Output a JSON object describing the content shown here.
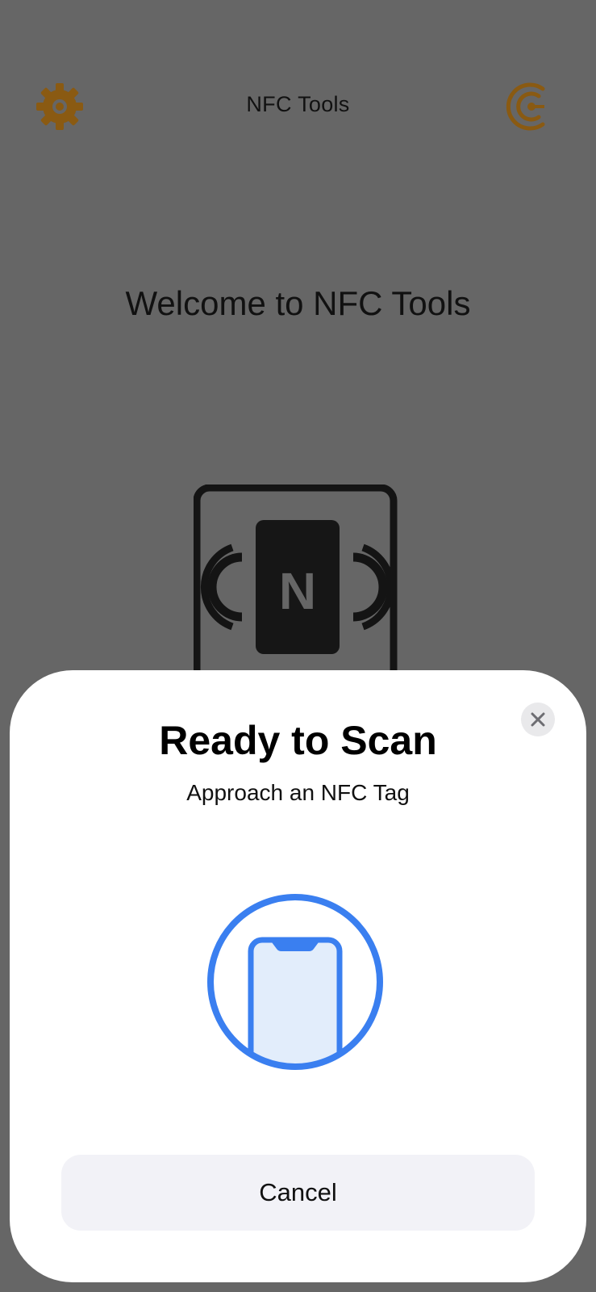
{
  "app": {
    "title": "NFC Tools",
    "welcome_text": "Welcome to NFC Tools",
    "nfc_badge_letter": "N",
    "icons": {
      "settings": "gear-icon",
      "logo": "app-logo-icon",
      "nfc": "nfc-tag-icon"
    },
    "colors": {
      "accent": "#8a5a12",
      "background_dimmed": "#666666"
    }
  },
  "scan_sheet": {
    "title": "Ready to Scan",
    "subtitle": "Approach an NFC Tag",
    "cancel_label": "Cancel",
    "icons": {
      "close": "close-icon",
      "phone": "phone-scan-icon"
    },
    "colors": {
      "accent": "#3a7ff0",
      "phone_fill": "#e2edfb",
      "button_bg": "#f2f2f7"
    }
  }
}
